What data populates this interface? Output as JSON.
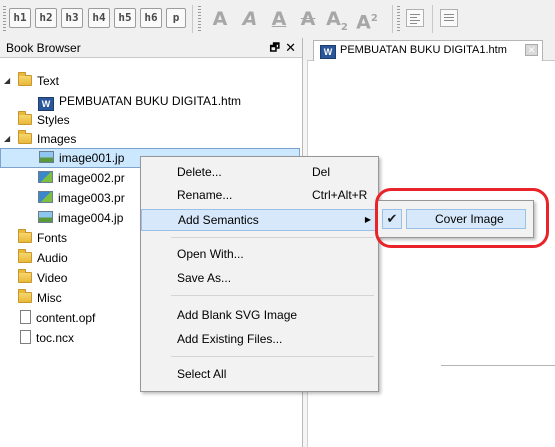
{
  "toolbar": {
    "heading_buttons": [
      "h1",
      "h2",
      "h3",
      "h4",
      "h5",
      "h6",
      "p"
    ]
  },
  "book_browser": {
    "title": "Book Browser",
    "float_glyph": "🗗",
    "close_glyph": "✕",
    "tree": [
      {
        "label": "Text",
        "icon": "folder-icon",
        "expanded": true
      },
      {
        "label": "PEMBUATAN BUKU DIGITA1.htm",
        "icon": "word-doc-icon"
      },
      {
        "label": "Styles",
        "icon": "folder-icon"
      },
      {
        "label": "Images",
        "icon": "folder-icon",
        "expanded": true
      },
      {
        "label": "image001.jp",
        "icon": "image-icon",
        "selected": true
      },
      {
        "label": "image002.pr",
        "icon": "image-icon"
      },
      {
        "label": "image003.pr",
        "icon": "image-icon"
      },
      {
        "label": "image004.jp",
        "icon": "image-icon"
      },
      {
        "label": "Fonts",
        "icon": "folder-icon"
      },
      {
        "label": "Audio",
        "icon": "folder-icon"
      },
      {
        "label": "Video",
        "icon": "folder-icon"
      },
      {
        "label": "Misc",
        "icon": "folder-icon"
      },
      {
        "label": "content.opf",
        "icon": "file-icon"
      },
      {
        "label": "toc.ncx",
        "icon": "file-icon"
      }
    ]
  },
  "editor": {
    "tab_label": "PEMBUATAN BUKU DIGITA1.htm",
    "tab_close_glyph": "✕"
  },
  "context_menu": {
    "items": [
      {
        "label": "Delete...",
        "shortcut": "Del"
      },
      {
        "label": "Rename...",
        "shortcut": "Ctrl+Alt+R"
      },
      {
        "label": "Add Semantics",
        "shortcut": "",
        "highlighted": true
      },
      {
        "label": "Open With...",
        "shortcut": ""
      },
      {
        "label": "Save As...",
        "shortcut": ""
      },
      {
        "label": "Add Blank SVG Image",
        "shortcut": ""
      },
      {
        "label": "Add Existing Files...",
        "shortcut": ""
      },
      {
        "label": "Select All",
        "shortcut": ""
      }
    ]
  },
  "submenu": {
    "item_label": "Cover Image",
    "checked": true,
    "check_glyph": "✔"
  },
  "colors": {
    "callout": "#e8242a",
    "selection": "#cce8ff",
    "menu_highlight": "#d6e8f9"
  }
}
